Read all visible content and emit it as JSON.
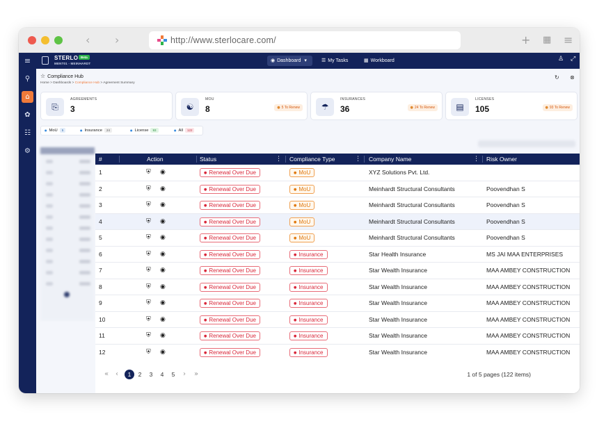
{
  "browser": {
    "url": "http://www.sterlocare.com/",
    "back_icon": "chevron-left-icon",
    "forward_icon": "chevron-right-icon"
  },
  "app": {
    "brand": "STERLO",
    "brand_badge": "Beta",
    "org": "MENT01 - MEINHARDT",
    "nav": {
      "dashboard": "Dashboard",
      "my_tasks": "My Tasks",
      "workboard": "Workboard"
    }
  },
  "page": {
    "title": "Compliance Hub",
    "breadcrumb": [
      "Home",
      "Dashboards",
      "Compliance Hub",
      "Agreement Summary"
    ]
  },
  "cards": [
    {
      "label": "AGREEMENTS",
      "value": "3",
      "chip": ""
    },
    {
      "label": "MOU",
      "value": "8",
      "chip": "5 To Renew"
    },
    {
      "label": "INSURANCES",
      "value": "36",
      "chip": "24 To Renew"
    },
    {
      "label": "LICENSES",
      "value": "105",
      "chip": "93 To Renew"
    }
  ],
  "filters": [
    {
      "label": "MoU",
      "count": "5"
    },
    {
      "label": "Insurance",
      "count": "24"
    },
    {
      "label": "License",
      "count": "93"
    },
    {
      "label": "All",
      "count": "122"
    }
  ],
  "table": {
    "columns": [
      "#",
      "Action",
      "Status",
      "Compliance Type",
      "Company Name",
      "Risk Owner"
    ],
    "rows": [
      {
        "num": "1",
        "status": "Renewal Over Due",
        "type": "MoU",
        "company": "XYZ Solutions Pvt. Ltd.",
        "owner": ""
      },
      {
        "num": "2",
        "status": "Renewal Over Due",
        "type": "MoU",
        "company": "Meinhardt Structural Consultants",
        "owner": "Poovendhan S"
      },
      {
        "num": "3",
        "status": "Renewal Over Due",
        "type": "MoU",
        "company": "Meinhardt Structural Consultants",
        "owner": "Poovendhan S"
      },
      {
        "num": "4",
        "status": "Renewal Over Due",
        "type": "MoU",
        "company": "Meinhardt Structural Consultants",
        "owner": "Poovendhan S"
      },
      {
        "num": "5",
        "status": "Renewal Over Due",
        "type": "MoU",
        "company": "Meinhardt Structural Consultants",
        "owner": "Poovendhan S"
      },
      {
        "num": "6",
        "status": "Renewal Over Due",
        "type": "Insurance",
        "company": "Star Health Insurance",
        "owner": "MS JAI MAA ENTERPRISES"
      },
      {
        "num": "7",
        "status": "Renewal Over Due",
        "type": "Insurance",
        "company": "Star Wealth Insurance",
        "owner": "MAA AMBEY CONSTRUCTION"
      },
      {
        "num": "8",
        "status": "Renewal Over Due",
        "type": "Insurance",
        "company": "Star Wealth Insurance",
        "owner": "MAA AMBEY CONSTRUCTION"
      },
      {
        "num": "9",
        "status": "Renewal Over Due",
        "type": "Insurance",
        "company": "Star Wealth Insurance",
        "owner": "MAA AMBEY CONSTRUCTION"
      },
      {
        "num": "10",
        "status": "Renewal Over Due",
        "type": "Insurance",
        "company": "Star Wealth Insurance",
        "owner": "MAA AMBEY CONSTRUCTION"
      },
      {
        "num": "11",
        "status": "Renewal Over Due",
        "type": "Insurance",
        "company": "Star Wealth Insurance",
        "owner": "MAA AMBEY CONSTRUCTION"
      },
      {
        "num": "12",
        "status": "Renewal Over Due",
        "type": "Insurance",
        "company": "Star Wealth Insurance",
        "owner": "MAA AMBEY CONSTRUCTION"
      }
    ]
  },
  "pagination": {
    "pages": [
      "1",
      "2",
      "3",
      "4",
      "5"
    ],
    "current": "1",
    "info": "1 of 5 pages (122 items)"
  },
  "colors": {
    "navy": "#13235a",
    "accent": "#f07a3a",
    "status_red": "#d9283a",
    "mou_orange": "#e07a10"
  }
}
